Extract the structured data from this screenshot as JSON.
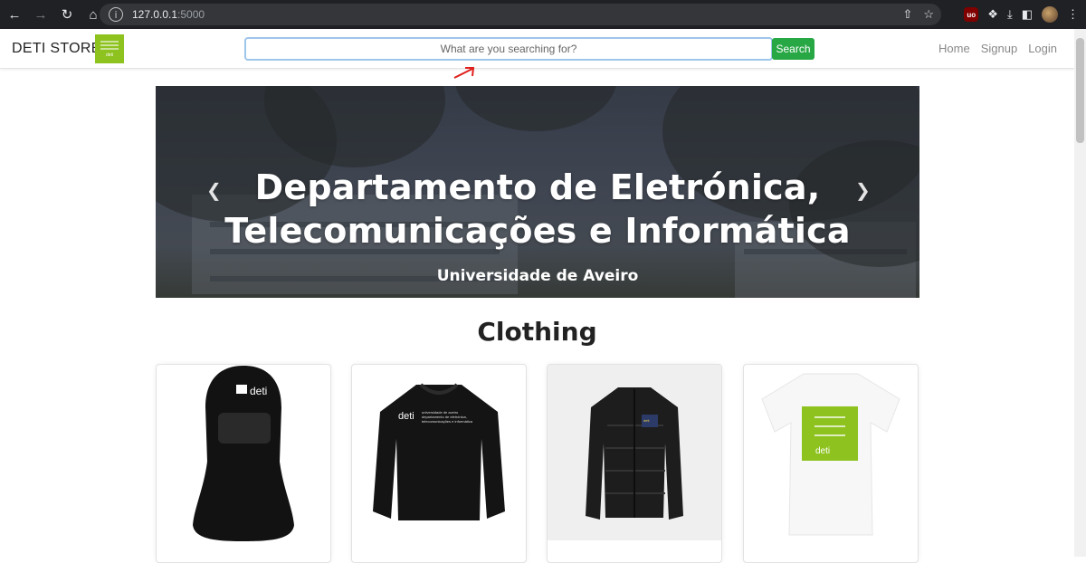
{
  "browser": {
    "url_host": "127.0.0.1",
    "url_port": ":5000"
  },
  "navbar": {
    "brand": "DETI STORE",
    "logo_text": "deti",
    "search_placeholder": "What are you searching for?",
    "search_button": "Search",
    "links": [
      "Home",
      "Signup",
      "Login"
    ]
  },
  "hero": {
    "title_line1": "Departamento de Eletrónica,",
    "title_line2": "Telecomunicações e Informática",
    "subtitle": "Universidade de Aveiro"
  },
  "section": {
    "title": "Clothing"
  },
  "products": [
    {
      "name": "balaclava",
      "brand_text": "deti"
    },
    {
      "name": "sweatshirt",
      "brand_text": "deti",
      "print_line1": "universidade de aveiro",
      "print_line2": "departamento de eletrónica,",
      "print_line3": "telecomunicações e informática"
    },
    {
      "name": "puffer-jacket",
      "patch_text": "deti"
    },
    {
      "name": "t-shirt",
      "brand_text": "deti"
    }
  ],
  "colors": {
    "accent_green": "#28a745",
    "logo_green": "#8dc21f"
  }
}
